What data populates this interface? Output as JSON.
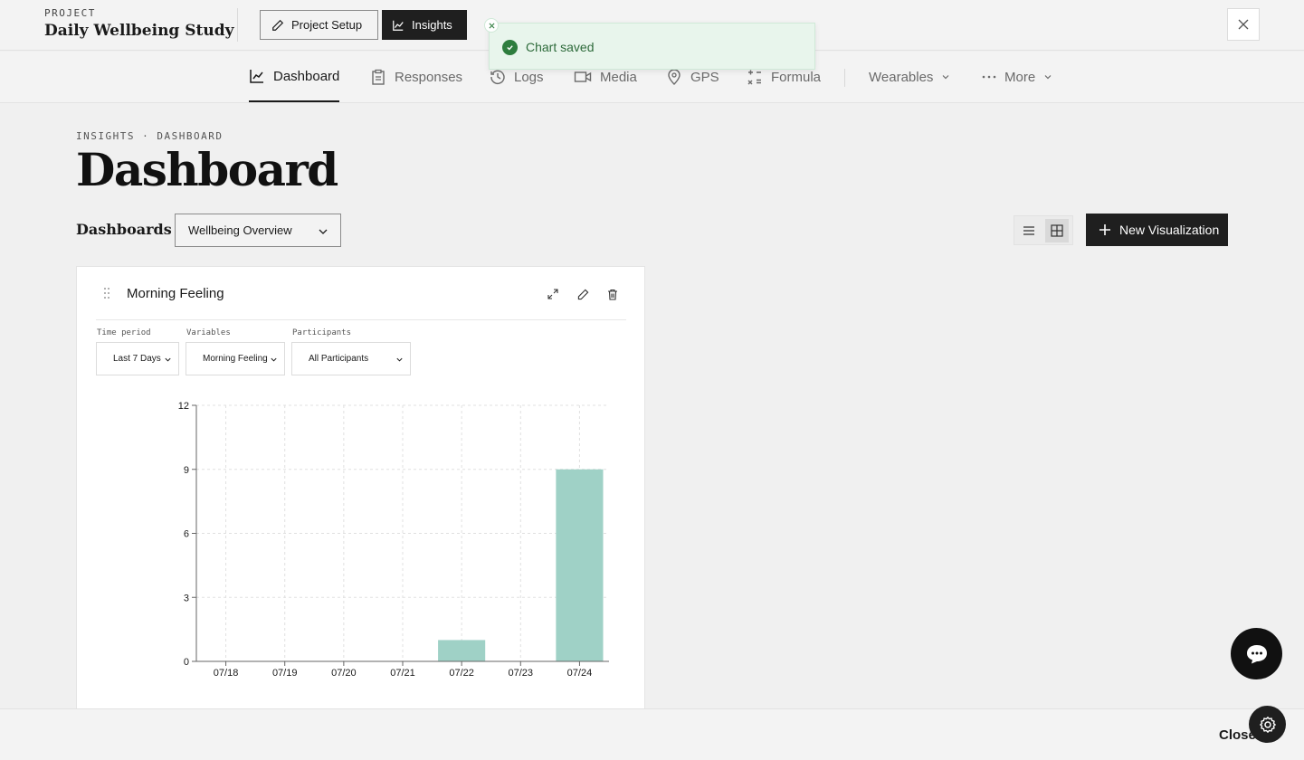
{
  "header": {
    "project_label": "PROJECT",
    "project_name": "Daily Wellbeing Study",
    "setup_label": "Project Setup",
    "insights_label": "Insights"
  },
  "toast": {
    "message": "Chart saved"
  },
  "nav": {
    "items": [
      {
        "label": "Dashboard",
        "icon": "line-chart-icon"
      },
      {
        "label": "Responses",
        "icon": "clipboard-icon"
      },
      {
        "label": "Logs",
        "icon": "history-icon"
      },
      {
        "label": "Media",
        "icon": "video-icon"
      },
      {
        "label": "GPS",
        "icon": "map-pin-icon"
      },
      {
        "label": "Formula",
        "icon": "formula-icon"
      },
      {
        "label": "Wearables",
        "icon": "chevron-down-icon"
      },
      {
        "label": "More",
        "icon": "more-icon"
      }
    ],
    "active": "Dashboard"
  },
  "page": {
    "breadcrumb": "INSIGHTS · DASHBOARD",
    "title": "Dashboard",
    "dashboards_label": "Dashboards",
    "selected_dashboard": "Wellbeing Overview",
    "new_viz_label": "New Visualization",
    "view_mode": "grid"
  },
  "card": {
    "title": "Morning Feeling",
    "filters": {
      "time_period_label": "Time period",
      "time_period_value": "Last 7 Days",
      "variables_label": "Variables",
      "variables_value": "Morning Feeling",
      "participants_label": "Participants",
      "participants_value": "All Participants"
    }
  },
  "chart_data": {
    "type": "bar",
    "categories": [
      "07/18",
      "07/19",
      "07/20",
      "07/21",
      "07/22",
      "07/23",
      "07/24"
    ],
    "values": [
      0,
      0,
      0,
      0,
      1,
      0,
      9
    ],
    "yticks": [
      0,
      3,
      6,
      9,
      12
    ],
    "ylim": [
      0,
      12
    ],
    "title": "",
    "xlabel": "",
    "ylabel": "",
    "grid": true,
    "bar_color": "#9fd1c6"
  },
  "footer": {
    "close_label": "Close"
  },
  "colors": {
    "accent": "#1f1f1f",
    "toast_bg": "#e8f5ec",
    "toast_text": "#2e6b3b",
    "success": "#2e7d3e"
  }
}
